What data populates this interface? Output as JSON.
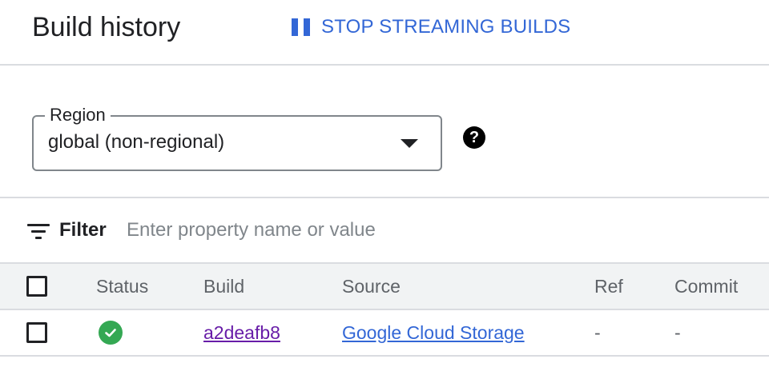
{
  "header": {
    "title": "Build history",
    "stop_button_label": "STOP STREAMING BUILDS"
  },
  "region": {
    "label": "Region",
    "value": "global (non-regional)"
  },
  "filter": {
    "label": "Filter",
    "placeholder": "Enter property name or value"
  },
  "table": {
    "columns": [
      "Status",
      "Build",
      "Source",
      "Ref",
      "Commit"
    ],
    "rows": [
      {
        "status": "success",
        "build": "a2deafb8",
        "source": "Google Cloud Storage",
        "ref": "-",
        "commit": "-"
      }
    ]
  },
  "colors": {
    "accent": "#3367d6",
    "visited_link": "#681da8",
    "success": "#34a853",
    "divider": "#dadce0",
    "header_bg": "#f1f3f4"
  },
  "icons": {
    "stop": "pause-icon",
    "region_help": "help-icon",
    "region_dropdown": "chevron-down-icon",
    "filter": "filter-icon",
    "status": "check-circle-icon"
  }
}
